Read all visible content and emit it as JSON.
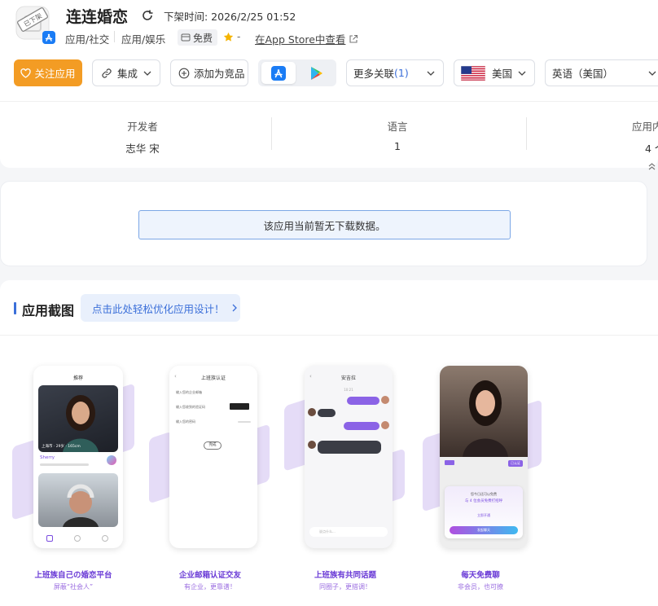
{
  "app": {
    "title": "连连婚恋",
    "delist_time": "下架时间: 2026/2/25 01:52",
    "delisted_stamp": "已下架",
    "categories": [
      "应用/社交",
      "应用/娱乐"
    ],
    "price": "免费",
    "rating": "-",
    "store_link": "在App Store中查看"
  },
  "toolbar": {
    "follow": "关注应用",
    "integrate": "集成",
    "add_compare": "添加为竞品",
    "more_label": "更多关联",
    "more_count": "(1)",
    "country": "美国",
    "language": "英语（美国）"
  },
  "stats": [
    {
      "label": "开发者",
      "value": "志华 宋"
    },
    {
      "label": "语言",
      "value": "1"
    },
    {
      "label": "应用内",
      "value": "4 个"
    }
  ],
  "download": {
    "notice": "该应用当前暂无下载数据。"
  },
  "screenshots": {
    "title": "应用截图",
    "optimize": "点击此处轻松优化应用设计！",
    "items": [
      {
        "caption": "上班族自己の婚恋平台",
        "sub": "屏蔽“社会人”",
        "screen_title": "推荐",
        "profile_name": "Sherry",
        "card_label": "上海市 · 29岁 · 165cm"
      },
      {
        "caption": "企业邮箱认证交友",
        "sub": "有企业，更靠谱！",
        "screen_title": "上班族认证",
        "button": "完成",
        "rows": [
          "输入您的企业邮箱",
          "输入您收到的验证码",
          "输入您的密码"
        ]
      },
      {
        "caption": "上班族有共同话题",
        "sub": "同圈子，更搭调！",
        "screen_title": "安吉拉",
        "time": "10:21",
        "msgs": [
          "Hi, 在吗？",
          "你好呀",
          "你在哪家公司上班",
          "我在阿里巴巴",
          "我们都是做互联网的，好巧"
        ],
        "input_placeholder": "说点什么..."
      },
      {
        "caption": "每天免费聊",
        "sub": "非会员，也可撩",
        "popup_title": "您今日还可以免费",
        "popup_line": "与 4 位会员免费打招呼",
        "popup_tip": "立即开通",
        "popup_button": "发起聊天",
        "tag": "已认证"
      }
    ]
  },
  "colors": {
    "accent": "#f39c24",
    "brand_blue": "#3b6fd9",
    "purple": "#6a3bd6"
  }
}
